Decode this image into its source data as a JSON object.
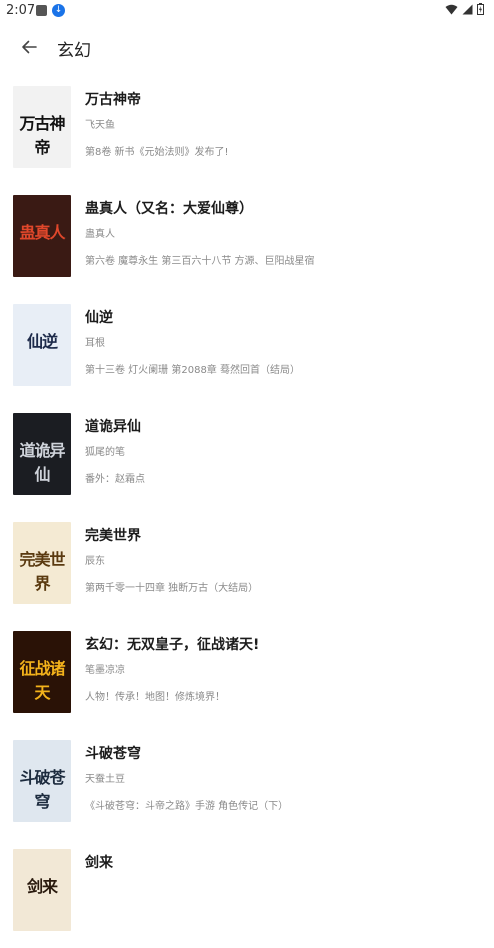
{
  "status_bar": {
    "time": "2:07"
  },
  "app_bar": {
    "title": "玄幻"
  },
  "colors": {
    "download_badge": "#1a73e8",
    "title_text": "#1c1c1c",
    "secondary_text": "#8a8a8a"
  },
  "books": [
    {
      "title": "万古神帝",
      "author": "飞天鱼",
      "latest": "第8卷 新书《元始法则》发布了!",
      "cover_text": "万古神帝",
      "cover_bg": "#f2f2f2",
      "cover_fg": "#111111"
    },
    {
      "title": "蛊真人（又名：大爱仙尊）",
      "author": "蛊真人",
      "latest": "第六卷 魔尊永生 第三百六十八节 方源、巨阳战星宿",
      "cover_text": "蛊真人",
      "cover_bg": "#3a1a14",
      "cover_fg": "#e0472b"
    },
    {
      "title": "仙逆",
      "author": "耳根",
      "latest": "第十三卷 灯火阑珊 第2088章 蓦然回首（结局）",
      "cover_text": "仙逆",
      "cover_bg": "#e8eef6",
      "cover_fg": "#1d2a4a"
    },
    {
      "title": "道诡异仙",
      "author": "狐尾的笔",
      "latest": "番外：赵霜点",
      "cover_text": "道诡异仙",
      "cover_bg": "#1b1d22",
      "cover_fg": "#cfd3da"
    },
    {
      "title": "完美世界",
      "author": "辰东",
      "latest": "第两千零一十四章 独断万古（大结局）",
      "cover_text": "完美世界",
      "cover_bg": "#f4ead3",
      "cover_fg": "#5a3a10"
    },
    {
      "title": "玄幻：无双皇子，征战诸天!",
      "author": "笔墨凉凉",
      "latest": "人物！传承！地图！修炼境界！",
      "cover_text": "征战诸天",
      "cover_bg": "#2a1206",
      "cover_fg": "#f3b21b"
    },
    {
      "title": "斗破苍穹",
      "author": "天蚕土豆",
      "latest": "《斗破苍穹：斗帝之路》手游 角色传记（下）",
      "cover_text": "斗破苍穹",
      "cover_bg": "#dfe7ef",
      "cover_fg": "#1c2b3e"
    },
    {
      "title": "剑来",
      "author": "",
      "latest": "",
      "cover_text": "剑来",
      "cover_bg": "#f2e8d6",
      "cover_fg": "#2a1a0e"
    }
  ]
}
